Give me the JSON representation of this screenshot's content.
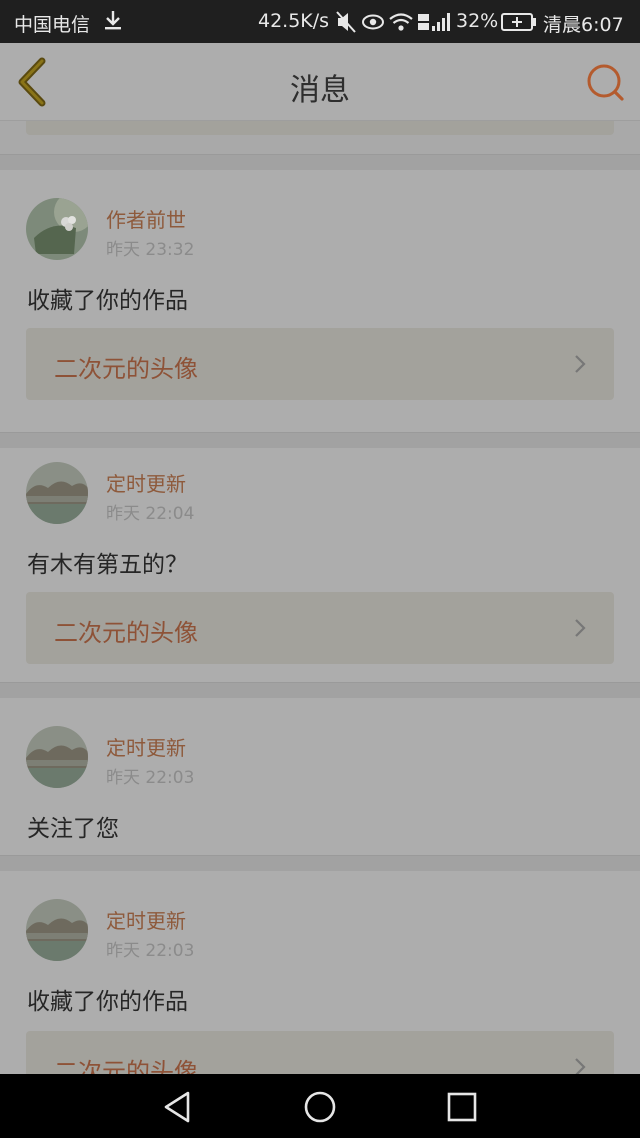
{
  "status_bar": {
    "carrier": "中国电信",
    "speed": "42.5K/s",
    "battery_percent": "32%",
    "time": "清晨6:07"
  },
  "header": {
    "title": "消息"
  },
  "colors": {
    "accent": "#e8743b",
    "overlay_bg": "#adadad"
  },
  "messages": [
    {
      "user": "作者前世",
      "time": "昨天 23:32",
      "text": "收藏了你的作品",
      "work": "二次元的头像"
    },
    {
      "user": "定时更新",
      "time": "昨天 22:04",
      "text": "有木有第五的？",
      "work": "二次元的头像"
    },
    {
      "user": "定时更新",
      "time": "昨天 22:03",
      "text": "关注了您"
    },
    {
      "user": "定时更新",
      "time": "昨天 22:03",
      "text": "收藏了你的作品",
      "work": "二次元的头像"
    }
  ]
}
